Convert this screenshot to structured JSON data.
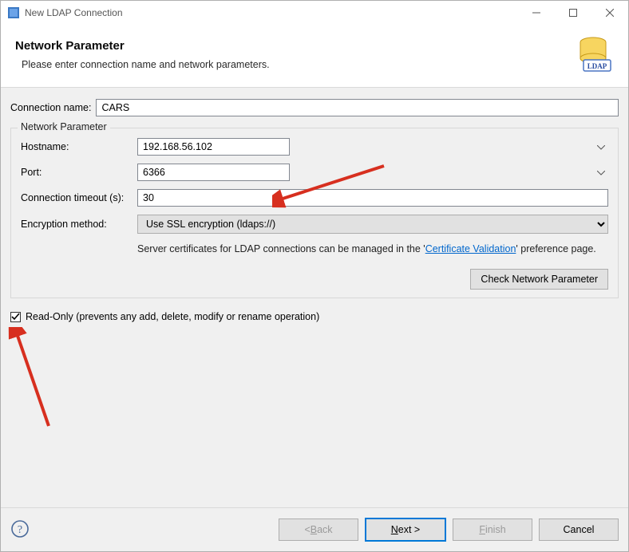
{
  "window": {
    "title": "New LDAP Connection"
  },
  "header": {
    "title": "Network Parameter",
    "subtitle": "Please enter connection name and network parameters.",
    "badge": "LDAP"
  },
  "form": {
    "connection_name_label": "Connection name:",
    "connection_name_value": "CARS",
    "fieldset_legend": "Network Parameter",
    "hostname_label": "Hostname:",
    "hostname_value": "192.168.56.102",
    "port_label": "Port:",
    "port_value": "6366",
    "timeout_label": "Connection timeout (s):",
    "timeout_value": "30",
    "encryption_label": "Encryption method:",
    "encryption_value": "Use SSL encryption (ldaps://)",
    "cert_hint_pre": "Server certificates for LDAP connections can be managed in the '",
    "cert_hint_link": "Certificate Validation",
    "cert_hint_post": "' preference page.",
    "check_network_btn": "Check Network Parameter",
    "readonly_label": "Read-Only (prevents any add, delete, modify or rename operation)",
    "readonly_checked": true
  },
  "buttons": {
    "back_pre": "< ",
    "back_u": "B",
    "back_post": "ack",
    "next_u": "N",
    "next_post": "ext >",
    "finish_u": "F",
    "finish_post": "inish",
    "cancel": "Cancel"
  }
}
